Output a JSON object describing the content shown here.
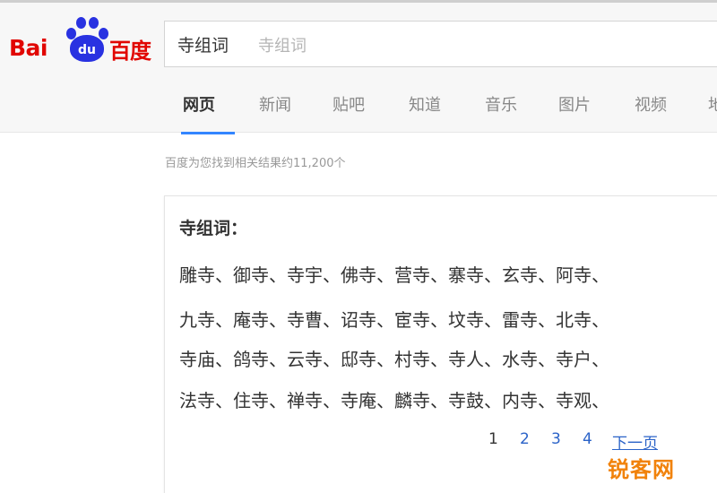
{
  "logo": {
    "latin": "Bai",
    "paw_text": "du",
    "chinese": "百度"
  },
  "search": {
    "query": "寺组词",
    "suggestion": "寺组词"
  },
  "tabs": [
    {
      "label": "网页",
      "active": true
    },
    {
      "label": "新闻",
      "active": false
    },
    {
      "label": "贴吧",
      "active": false
    },
    {
      "label": "知道",
      "active": false
    },
    {
      "label": "音乐",
      "active": false
    },
    {
      "label": "图片",
      "active": false
    },
    {
      "label": "视频",
      "active": false
    },
    {
      "label": "地",
      "active": false
    }
  ],
  "result_count": "百度为您找到相关结果约11,200个",
  "card": {
    "title": "寺组词：",
    "rows": [
      [
        "雕寺、",
        "御寺、",
        "寺宇、",
        "佛寺、",
        "营寺、",
        "寨寺、",
        "玄寺、",
        "阿寺、"
      ],
      [
        "九寺、",
        "庵寺、",
        "寺曹、",
        "诏寺、",
        "宦寺、",
        "坟寺、",
        "雷寺、",
        "北寺、"
      ],
      [
        "寺庙、",
        "鸽寺、",
        "云寺、",
        "邸寺、",
        "村寺、",
        "寺人、",
        "水寺、",
        "寺户、"
      ],
      [
        "法寺、",
        "住寺、",
        "禅寺、",
        "寺庵、",
        "麟寺、",
        "寺鼓、",
        "内寺、",
        "寺观、"
      ]
    ],
    "pagination": {
      "pages": [
        "1",
        "2",
        "3",
        "4"
      ],
      "current": "1",
      "next": "下一页"
    }
  },
  "watermark": "锐客网",
  "colors": {
    "brand_red": "#e10602",
    "brand_blue": "#2932e1",
    "tab_underline": "#3385ff",
    "link": "#2b63c8",
    "watermark": "#f1820a"
  }
}
